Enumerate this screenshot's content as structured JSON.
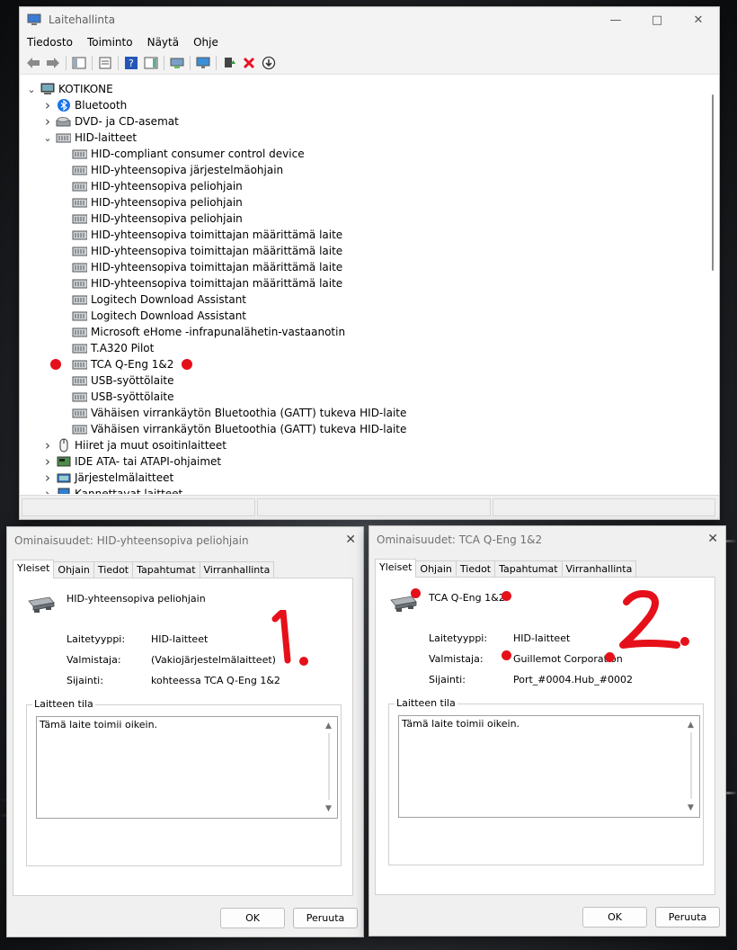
{
  "main_window": {
    "title": "Laitehallinta",
    "menu": [
      "Tiedosto",
      "Toiminto",
      "Näytä",
      "Ohje"
    ],
    "tree": [
      {
        "level": 0,
        "chevron": "down",
        "icon": "computer",
        "label": "KOTIKONE"
      },
      {
        "level": 1,
        "chevron": "right",
        "icon": "bluetooth",
        "label": "Bluetooth"
      },
      {
        "level": 1,
        "chevron": "right",
        "icon": "dvd",
        "label": "DVD- ja CD-asemat"
      },
      {
        "level": 1,
        "chevron": "down",
        "icon": "hid",
        "label": "HID-laitteet"
      },
      {
        "level": 2,
        "icon": "hid",
        "label": "HID-compliant consumer control device"
      },
      {
        "level": 2,
        "icon": "hid",
        "label": "HID-yhteensopiva järjestelmäohjain"
      },
      {
        "level": 2,
        "icon": "hid",
        "label": "HID-yhteensopiva peliohjain"
      },
      {
        "level": 2,
        "icon": "hid",
        "label": "HID-yhteensopiva peliohjain"
      },
      {
        "level": 2,
        "icon": "hid",
        "label": "HID-yhteensopiva peliohjain"
      },
      {
        "level": 2,
        "icon": "hid",
        "label": "HID-yhteensopiva toimittajan määrittämä laite"
      },
      {
        "level": 2,
        "icon": "hid",
        "label": "HID-yhteensopiva toimittajan määrittämä laite"
      },
      {
        "level": 2,
        "icon": "hid",
        "label": "HID-yhteensopiva toimittajan määrittämä laite"
      },
      {
        "level": 2,
        "icon": "hid",
        "label": "HID-yhteensopiva toimittajan määrittämä laite"
      },
      {
        "level": 2,
        "icon": "hid",
        "label": "Logitech Download Assistant"
      },
      {
        "level": 2,
        "icon": "hid",
        "label": "Logitech Download Assistant"
      },
      {
        "level": 2,
        "icon": "hid",
        "label": "Microsoft eHome -infrapunalähetin-vastaanotin"
      },
      {
        "level": 2,
        "icon": "hid",
        "label": "T.A320 Pilot"
      },
      {
        "level": 2,
        "icon": "hid",
        "label": "TCA Q-Eng 1&2",
        "marked": true
      },
      {
        "level": 2,
        "icon": "hid",
        "label": "USB-syöttölaite"
      },
      {
        "level": 2,
        "icon": "hid",
        "label": "USB-syöttölaite"
      },
      {
        "level": 2,
        "icon": "hid",
        "label": "Vähäisen virrankäytön Bluetoothia (GATT) tukeva HID-laite"
      },
      {
        "level": 2,
        "icon": "hid",
        "label": "Vähäisen virrankäytön Bluetoothia (GATT) tukeva HID-laite"
      },
      {
        "level": 1,
        "chevron": "right",
        "icon": "mouse",
        "label": "Hiiret ja muut osoitinlaitteet"
      },
      {
        "level": 1,
        "chevron": "right",
        "icon": "ide",
        "label": "IDE ATA- tai ATAPI-ohjaimet"
      },
      {
        "level": 1,
        "chevron": "right",
        "icon": "system",
        "label": "Järjestelmälaitteet"
      },
      {
        "level": 1,
        "chevron": "right",
        "icon": "portable",
        "label": "Kannettavat laitteet"
      }
    ]
  },
  "dialog1": {
    "title": "Ominaisuudet: HID-yhteensopiva peliohjain",
    "tabs": [
      "Yleiset",
      "Ohjain",
      "Tiedot",
      "Tapahtumat",
      "Virranhallinta"
    ],
    "device_name": "HID-yhteensopiva peliohjain",
    "type_label": "Laitetyyppi:",
    "type_value": "HID-laitteet",
    "manufacturer_label": "Valmistaja:",
    "manufacturer_value": "(Vakiojärjestelmälaitteet)",
    "location_label": "Sijainti:",
    "location_value": "kohteessa TCA Q-Eng 1&2",
    "status_group": "Laitteen tila",
    "status_text": "Tämä laite toimii oikein.",
    "ok": "OK",
    "cancel": "Peruuta",
    "annotation": "1."
  },
  "dialog2": {
    "title": "Ominaisuudet: TCA Q-Eng 1&2",
    "tabs": [
      "Yleiset",
      "Ohjain",
      "Tiedot",
      "Tapahtumat",
      "Virranhallinta"
    ],
    "device_name": "TCA Q-Eng 1&2",
    "type_label": "Laitetyyppi:",
    "type_value": "HID-laitteet",
    "manufacturer_label": "Valmistaja:",
    "manufacturer_value": "Guillemot Corporation",
    "location_label": "Sijainti:",
    "location_value": "Port_#0004.Hub_#0002",
    "status_group": "Laitteen tila",
    "status_text": "Tämä laite toimii oikein.",
    "ok": "OK",
    "cancel": "Peruuta",
    "annotation": "2."
  },
  "colors": {
    "annotation_red": "#e5101a",
    "toolbar_delete_red": "#e81123"
  }
}
